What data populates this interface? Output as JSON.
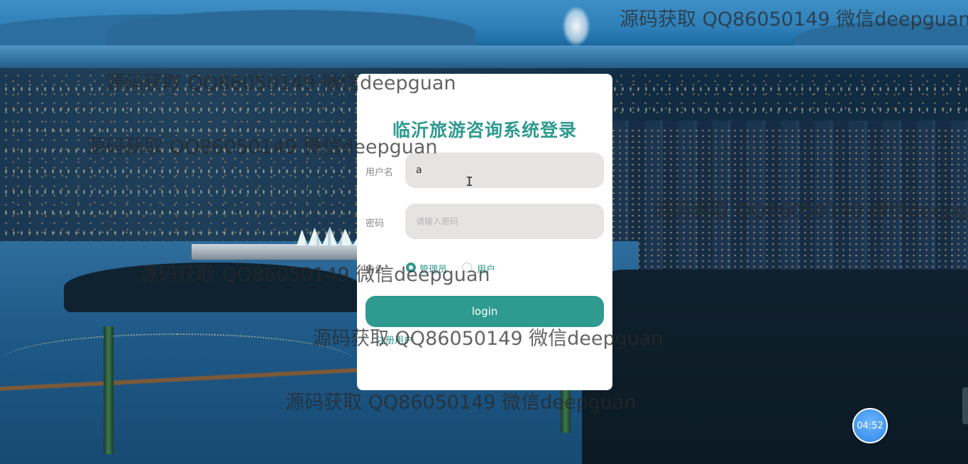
{
  "login": {
    "title": "临沂旅游咨询系统登录",
    "username_label": "用户名",
    "username_value": "a",
    "password_label": "密码",
    "password_placeholder": "请输入密码",
    "role_label": "角色",
    "roles": [
      {
        "label": "管理员",
        "selected": true
      },
      {
        "label": "用户",
        "selected": false
      }
    ],
    "login_button": "login",
    "register_link": "注册用户"
  },
  "watermark_text": "源码获取 QQ86050149 微信deepguan",
  "timer": "04:52",
  "colors": {
    "accent": "#2e9a90",
    "input_bg": "#e6e3e3",
    "timer_bg": "#2f86e8"
  }
}
